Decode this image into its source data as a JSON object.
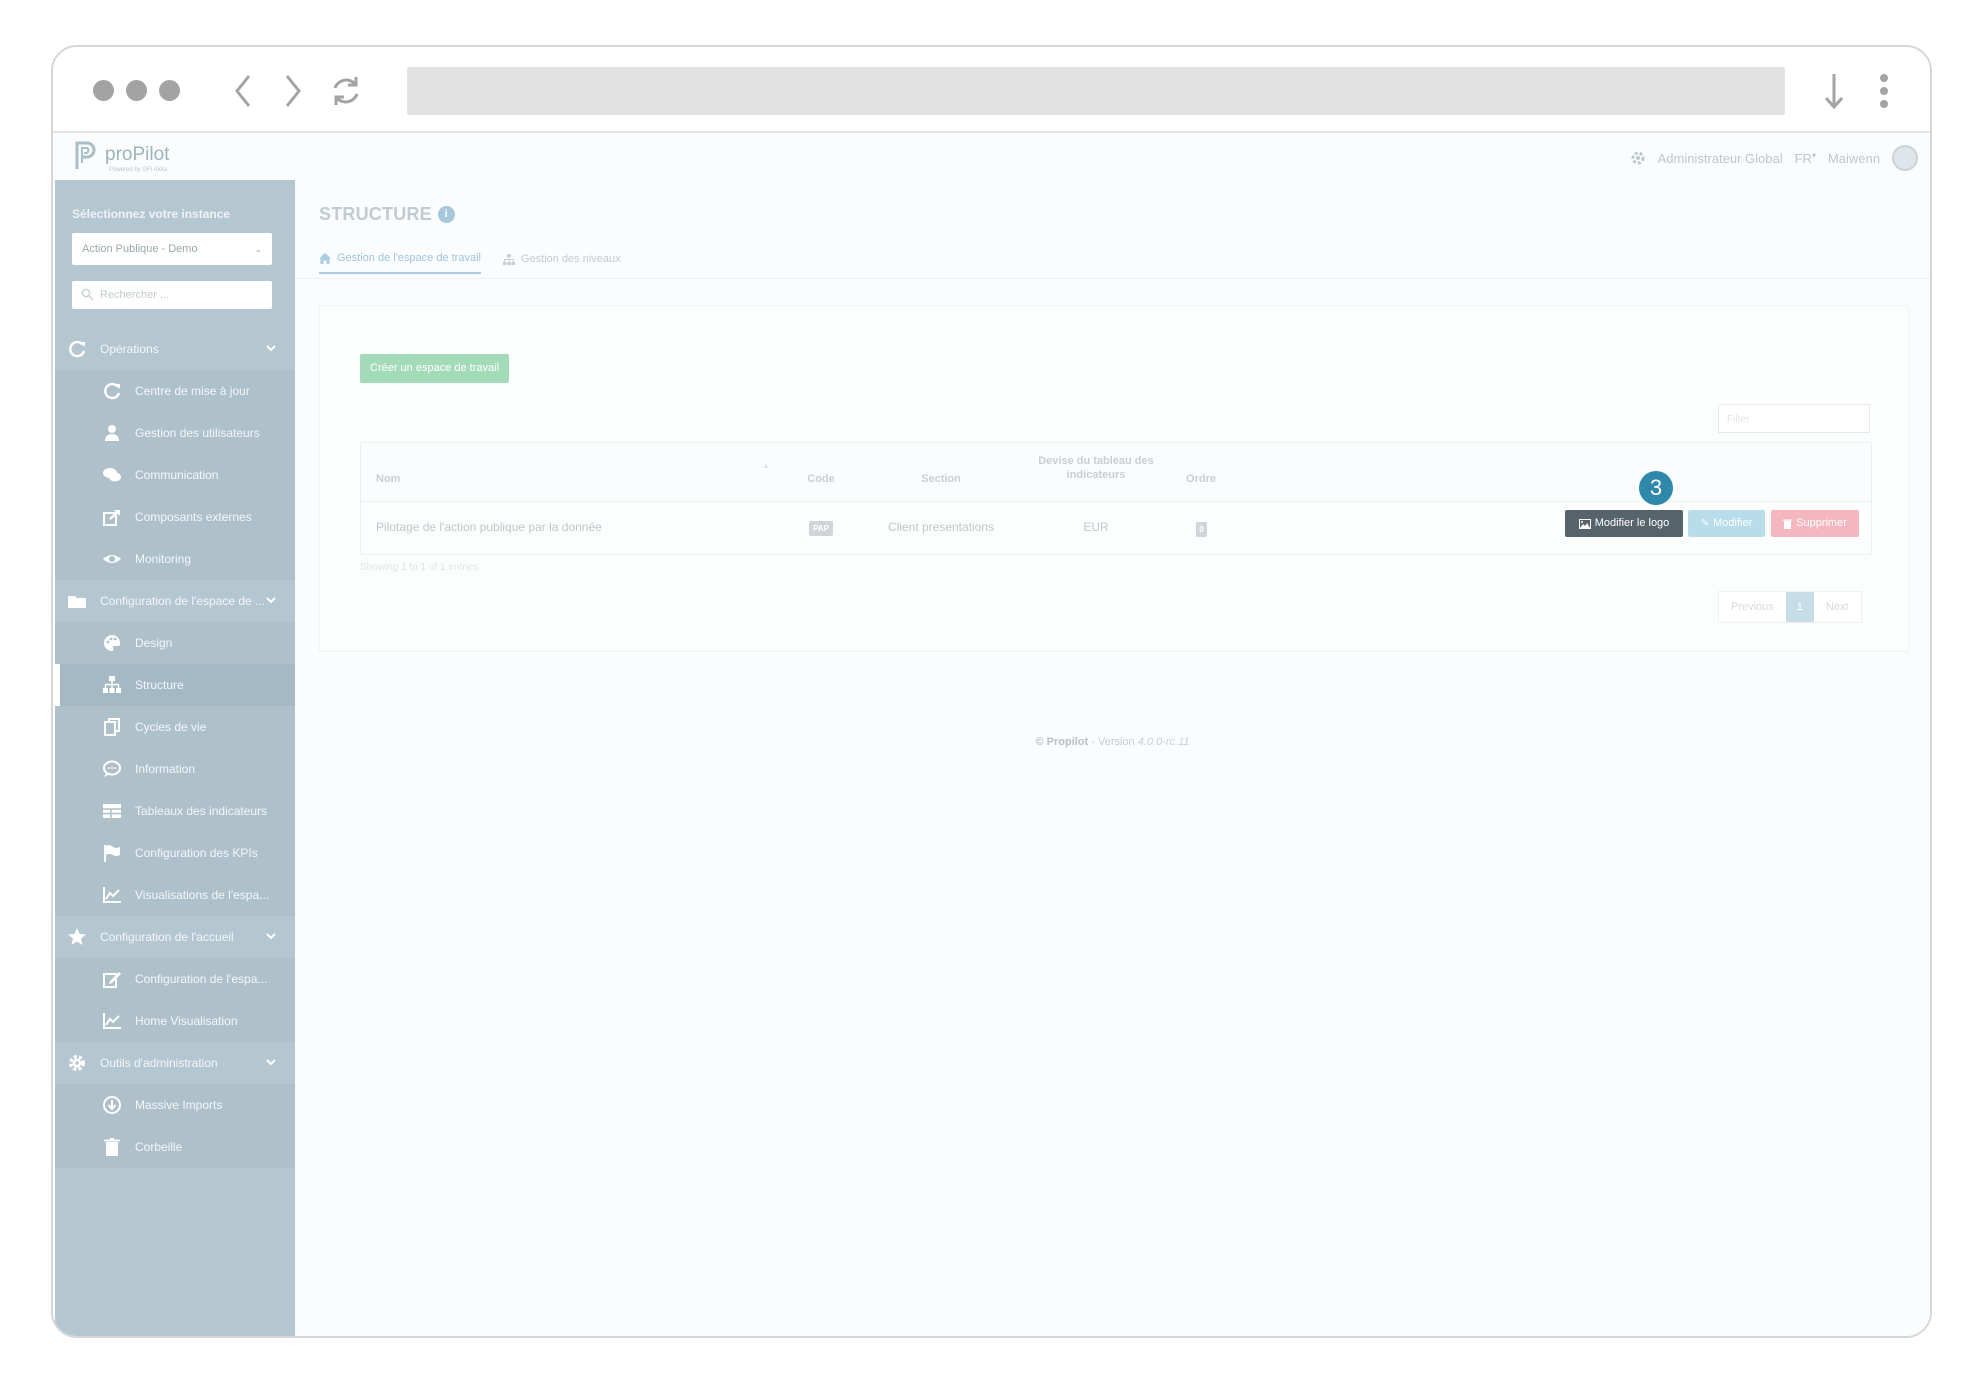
{
  "app": {
    "logo_text": "proPilot",
    "logo_sub": "Powered by GFI Akka"
  },
  "topbar": {
    "role": "Administrateur Global",
    "language": "FR",
    "user": "Maiwenn"
  },
  "sidebar": {
    "instance_heading": "Sélectionnez votre instance",
    "instance_value": "Action Publique - Demo",
    "search_placeholder": "Rechercher ...",
    "items": [
      {
        "label": "Opérations",
        "icon": "refresh-icon",
        "type": "category"
      },
      {
        "label": "Centre de mise à jour",
        "icon": "refresh-icon",
        "type": "sub"
      },
      {
        "label": "Gestion des utilisateurs",
        "icon": "user-icon",
        "type": "sub"
      },
      {
        "label": "Communication",
        "icon": "chat-icon",
        "type": "sub"
      },
      {
        "label": "Composants externes",
        "icon": "share-icon",
        "type": "sub"
      },
      {
        "label": "Monitoring",
        "icon": "eye-icon",
        "type": "sub"
      },
      {
        "label": "Configuration de l'espace de ...",
        "icon": "folder-icon",
        "type": "category"
      },
      {
        "label": "Design",
        "icon": "palette-icon",
        "type": "sub"
      },
      {
        "label": "Structure",
        "icon": "sitemap-icon",
        "type": "sub",
        "active": true
      },
      {
        "label": "Cycles de vie",
        "icon": "copy-icon",
        "type": "sub"
      },
      {
        "label": "Information",
        "icon": "comment-icon",
        "type": "sub"
      },
      {
        "label": "Tableaux des indicateurs",
        "icon": "table-icon",
        "type": "sub"
      },
      {
        "label": "Configuration des KPIs",
        "icon": "flag-icon",
        "type": "sub"
      },
      {
        "label": "Visualisations de l'espa...",
        "icon": "chart-icon",
        "type": "sub"
      },
      {
        "label": "Configuration de l'accueil",
        "icon": "star-icon",
        "type": "category"
      },
      {
        "label": "Configuration de l'espa...",
        "icon": "edit-icon",
        "type": "sub"
      },
      {
        "label": "Home Visualisation",
        "icon": "chart-icon",
        "type": "sub"
      },
      {
        "label": "Outils d'administration",
        "icon": "gear-icon",
        "type": "category"
      },
      {
        "label": "Massive Imports",
        "icon": "download-circle-icon",
        "type": "sub"
      },
      {
        "label": "Corbeille",
        "icon": "trash-icon",
        "type": "sub"
      }
    ]
  },
  "main": {
    "title": "STRUCTURE",
    "tabs": [
      {
        "label": "Gestion de l'espace de travail",
        "icon": "home-icon",
        "active": true
      },
      {
        "label": "Gestion des niveaux",
        "icon": "sitemap-icon",
        "active": false
      }
    ],
    "create_button": "Créer un espace de travail",
    "filter_placeholder": "Filter",
    "table": {
      "headers": {
        "nom": "Nom",
        "code": "Code",
        "section": "Section",
        "devise_line1": "Devise du tableau des",
        "devise_line2": "indicateurs",
        "ordre": "Ordre"
      },
      "rows": [
        {
          "nom": "Pilotage de l'action publique par la donnée",
          "code": "PAP",
          "section": "Client presentations",
          "devise": "EUR",
          "ordre": "0"
        }
      ],
      "actions": {
        "logo": "Modifier le logo",
        "modify": "Modifier",
        "delete": "Supprimer"
      }
    },
    "step_marker": "3",
    "showing": "Showing 1 to 1 of 1 entries",
    "pagination": {
      "previous": "Previous",
      "current": "1",
      "next": "Next"
    }
  },
  "footer": {
    "brand": "© Propilot",
    "sep": " - Version ",
    "version": "4.0.0-rc.11"
  },
  "colors": {
    "sidebar": "#b4c6d0",
    "create_button": "#a3dbb9",
    "logo_button": "#57636b",
    "modify_button": "#b8dcea",
    "delete_button": "#f5b7bf",
    "marker": "#2f87a9"
  }
}
